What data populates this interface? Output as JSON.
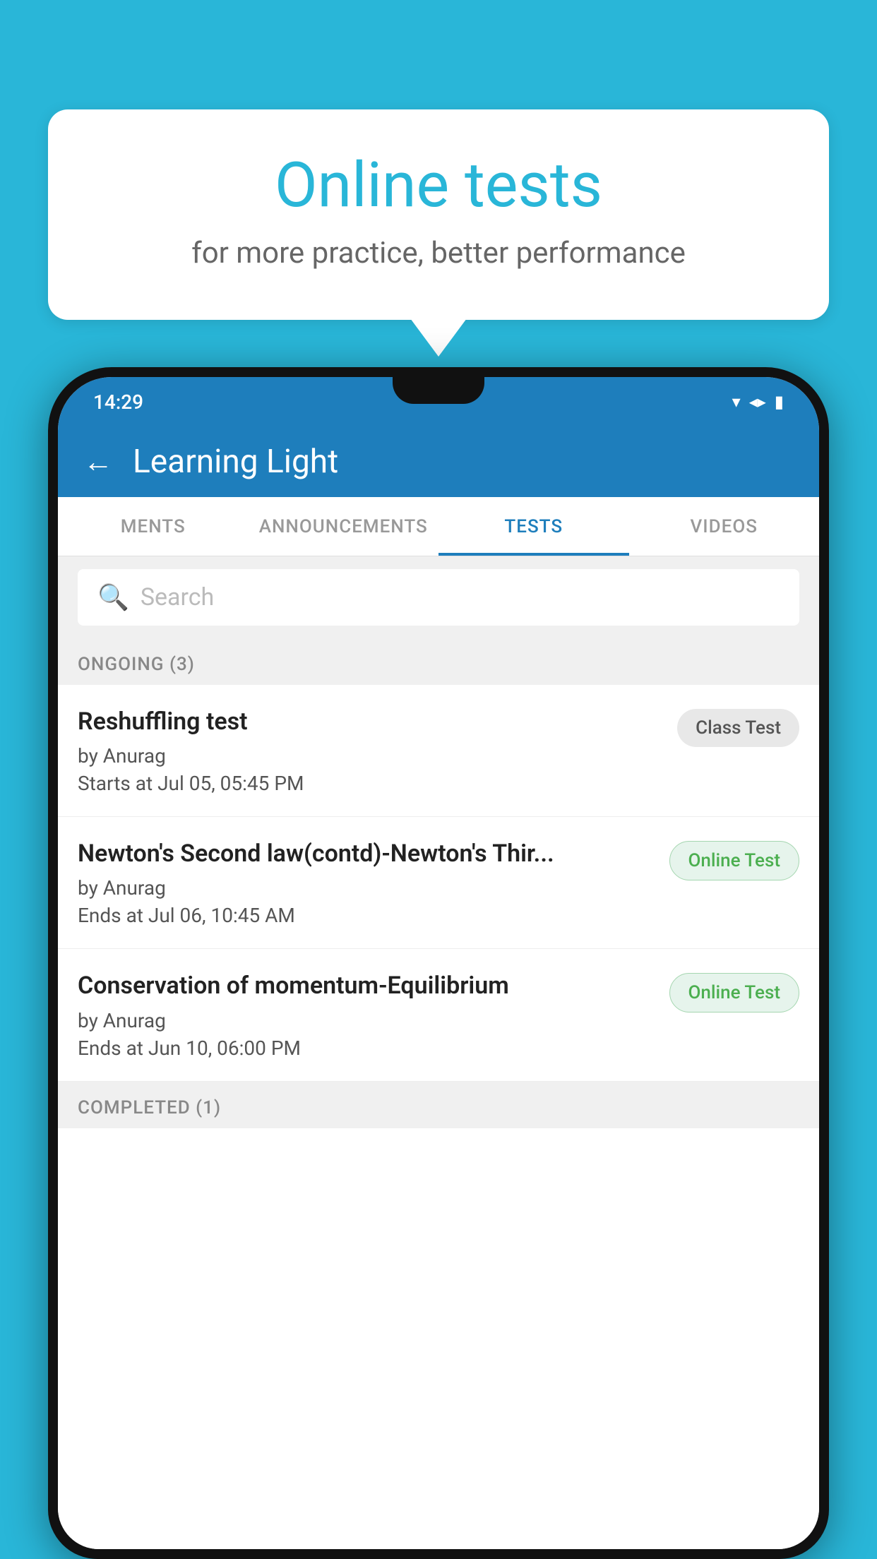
{
  "background": {
    "color": "#29b6d8"
  },
  "speech_bubble": {
    "title": "Online tests",
    "subtitle": "for more practice, better performance"
  },
  "phone": {
    "status_bar": {
      "time": "14:29",
      "icons": [
        "▾",
        "◂▸",
        "▮"
      ]
    },
    "app_bar": {
      "back_label": "←",
      "title": "Learning Light"
    },
    "tabs": [
      {
        "label": "MENTS",
        "active": false
      },
      {
        "label": "ANNOUNCEMENTS",
        "active": false
      },
      {
        "label": "TESTS",
        "active": true
      },
      {
        "label": "VIDEOS",
        "active": false
      }
    ],
    "search": {
      "placeholder": "Search"
    },
    "ongoing_section": {
      "header": "ONGOING (3)",
      "tests": [
        {
          "name": "Reshuffling test",
          "author": "by Anurag",
          "time_label": "Starts at",
          "time": "Jul 05, 05:45 PM",
          "badge": "Class Test",
          "badge_type": "class"
        },
        {
          "name": "Newton's Second law(contd)-Newton's Thir...",
          "author": "by Anurag",
          "time_label": "Ends at",
          "time": "Jul 06, 10:45 AM",
          "badge": "Online Test",
          "badge_type": "online"
        },
        {
          "name": "Conservation of momentum-Equilibrium",
          "author": "by Anurag",
          "time_label": "Ends at",
          "time": "Jun 10, 06:00 PM",
          "badge": "Online Test",
          "badge_type": "online"
        }
      ]
    },
    "completed_section": {
      "header": "COMPLETED (1)"
    }
  }
}
